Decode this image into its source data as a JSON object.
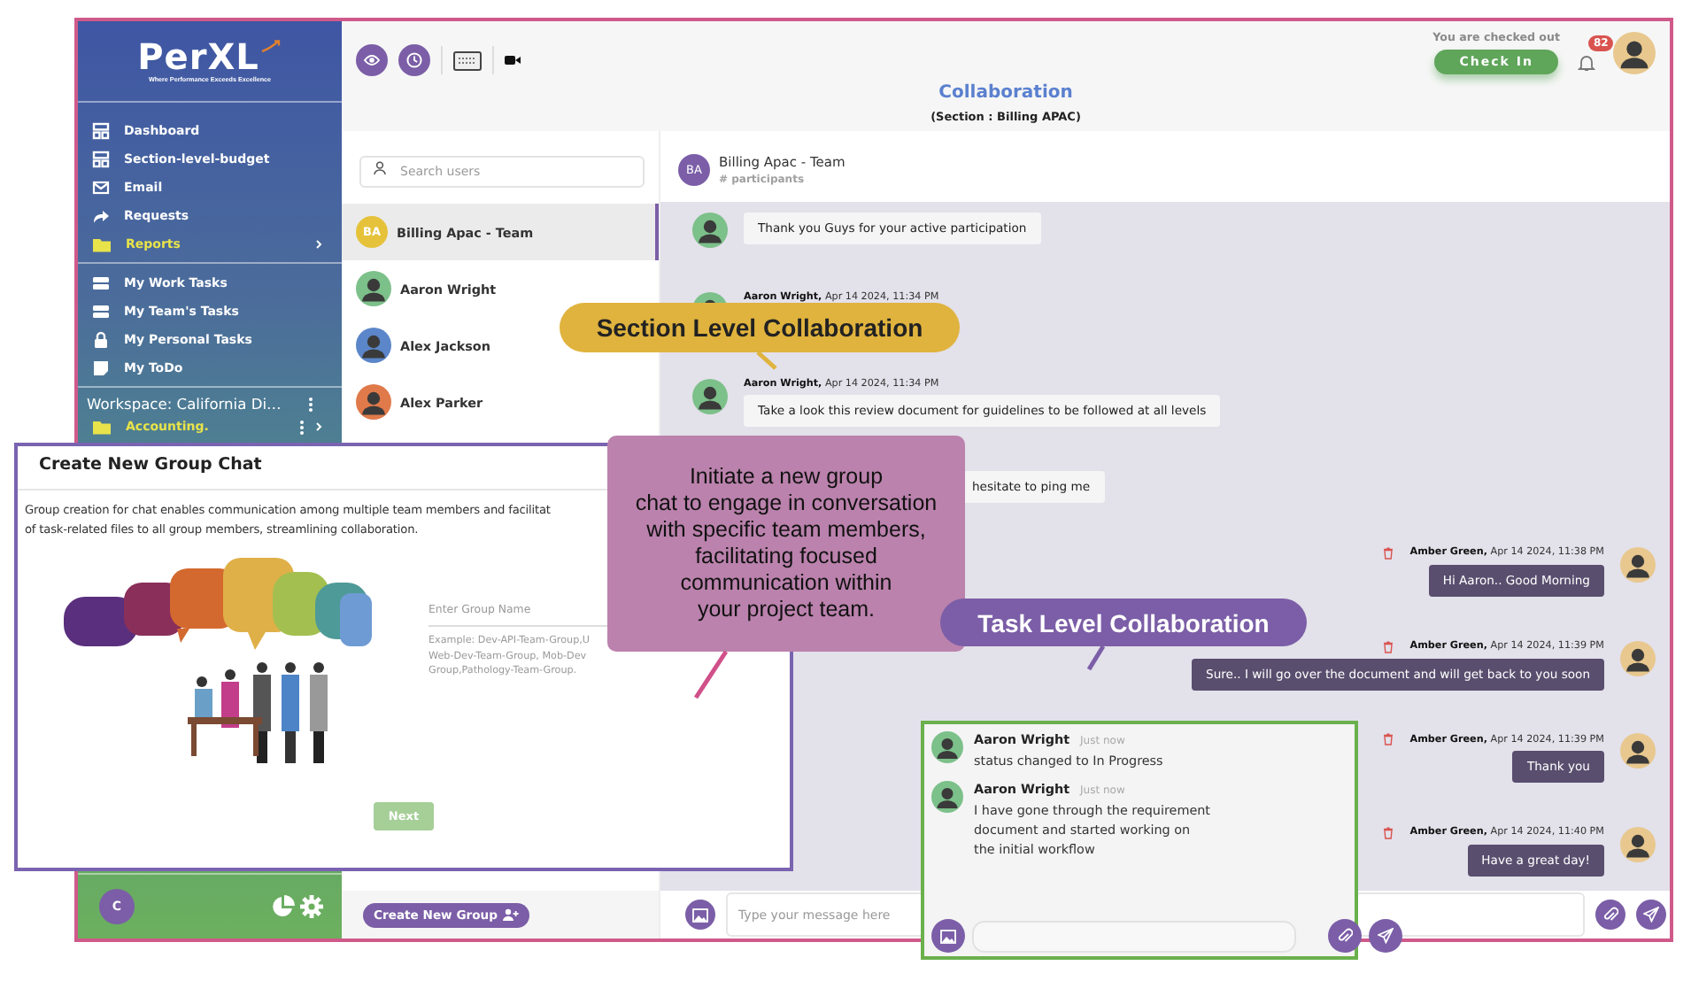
{
  "sidebar": {
    "logo": {
      "name": "PerXL",
      "tagline": "Where Performance Exceeds Excellence"
    },
    "groups": [
      {
        "items": [
          {
            "label": "Dashboard",
            "kind": "link"
          },
          {
            "label": "Section-level-budget",
            "kind": "link"
          },
          {
            "label": "Email",
            "kind": "link"
          },
          {
            "label": "Requests",
            "kind": "link"
          },
          {
            "label": "Reports",
            "kind": "folder"
          }
        ]
      },
      {
        "items": [
          {
            "label": "My Work Tasks",
            "kind": "link"
          },
          {
            "label": "My Team's Tasks",
            "kind": "link"
          },
          {
            "label": "My Personal Tasks",
            "kind": "link"
          },
          {
            "label": "My ToDo",
            "kind": "link"
          }
        ]
      }
    ],
    "workspace": {
      "label": "Workspace: California Di…",
      "items": [
        {
          "label": "Accounting.",
          "kind": "folder"
        }
      ]
    },
    "footer": {
      "avatar": "C"
    }
  },
  "toolbar": {
    "title": "Collaboration",
    "subtitle": "(Section : Billing APAC)",
    "check_status": "You are checked out",
    "check_in_button": "Check In",
    "notification_count": "82"
  },
  "users": {
    "search_placeholder": "Search users",
    "items": [
      {
        "name": "Billing Apac - Team",
        "initials": "BA",
        "selected": true,
        "color": "#e6c23a"
      },
      {
        "name": "Aaron Wright",
        "selected": false,
        "color": "#7cc08a"
      },
      {
        "name": "Alex Jackson",
        "selected": false,
        "color": "#5b86c9"
      },
      {
        "name": "Alex Parker",
        "selected": false,
        "color": "#e07a4a"
      }
    ],
    "create_button": "Create New Group"
  },
  "chat": {
    "header": {
      "initials": "BA",
      "name": "Billing Apac - Team",
      "subtitle": "# participants"
    },
    "messages": [
      {
        "kind": "incoming",
        "avatar": true,
        "text": "Thank you Guys for your active participation"
      },
      {
        "kind": "incoming",
        "avatar": true,
        "sender": "Aaron Wright,",
        "time": "Apr 14 2024, 11:34 PM"
      },
      {
        "kind": "incoming",
        "avatar": true,
        "sender": "Aaron Wright,",
        "time": "Apr 14 2024, 11:34 PM",
        "text": "Take a look this review document for guidelines to be followed at all levels"
      },
      {
        "kind": "incoming",
        "avatar": false,
        "text": "hesitate to ping me"
      },
      {
        "kind": "outgoing",
        "avatar": true,
        "sender": "Amber Green,",
        "time": "Apr 14 2024, 11:38 PM",
        "text": "Hi Aaron.. Good Morning"
      },
      {
        "kind": "outgoing",
        "avatar": true,
        "sender": "Amber Green,",
        "time": "Apr 14 2024, 11:39 PM",
        "text": "Sure.. I will go over the document and will get back to you soon"
      },
      {
        "kind": "outgoing",
        "avatar": true,
        "sender": "Amber Green,",
        "time": "Apr 14 2024, 11:39 PM",
        "text": "Thank you"
      },
      {
        "kind": "outgoing",
        "avatar": true,
        "sender": "Amber Green,",
        "time": "Apr 14 2024, 11:40 PM",
        "text": "Have a great day!"
      }
    ],
    "input_placeholder": "Type your message here"
  },
  "modal": {
    "title": "Create New Group Chat",
    "description_lines": [
      "Group creation for chat enables communication among multiple team members and facilitat",
      "of task-related files to all group members, streamlining collaboration."
    ],
    "field_placeholder": "Enter Group Name",
    "example": "Example: Dev-API-Team-Group,U\nWeb-Dev-Team-Group, Mob-Dev\nGroup,Pathology-Team-Group.",
    "next_button": "Next"
  },
  "callouts": [
    {
      "kind": "section",
      "text": "Section Level Collaboration"
    },
    {
      "kind": "info",
      "text": "Initiate a new group\nchat to engage in conversation\nwith specific team members,\nfacilitating focused\ncommunication within\nyour project team."
    },
    {
      "kind": "task",
      "text": "Task Level Collaboration"
    }
  ],
  "task_popup": {
    "messages": [
      {
        "sender": "Aaron Wright",
        "time": "Just now",
        "text": "status changed to In Progress"
      },
      {
        "sender": "Aaron Wright",
        "time": "Just now",
        "text": "I have gone through the requirement\ndocument and started working on\nthe initial workflow"
      }
    ]
  }
}
